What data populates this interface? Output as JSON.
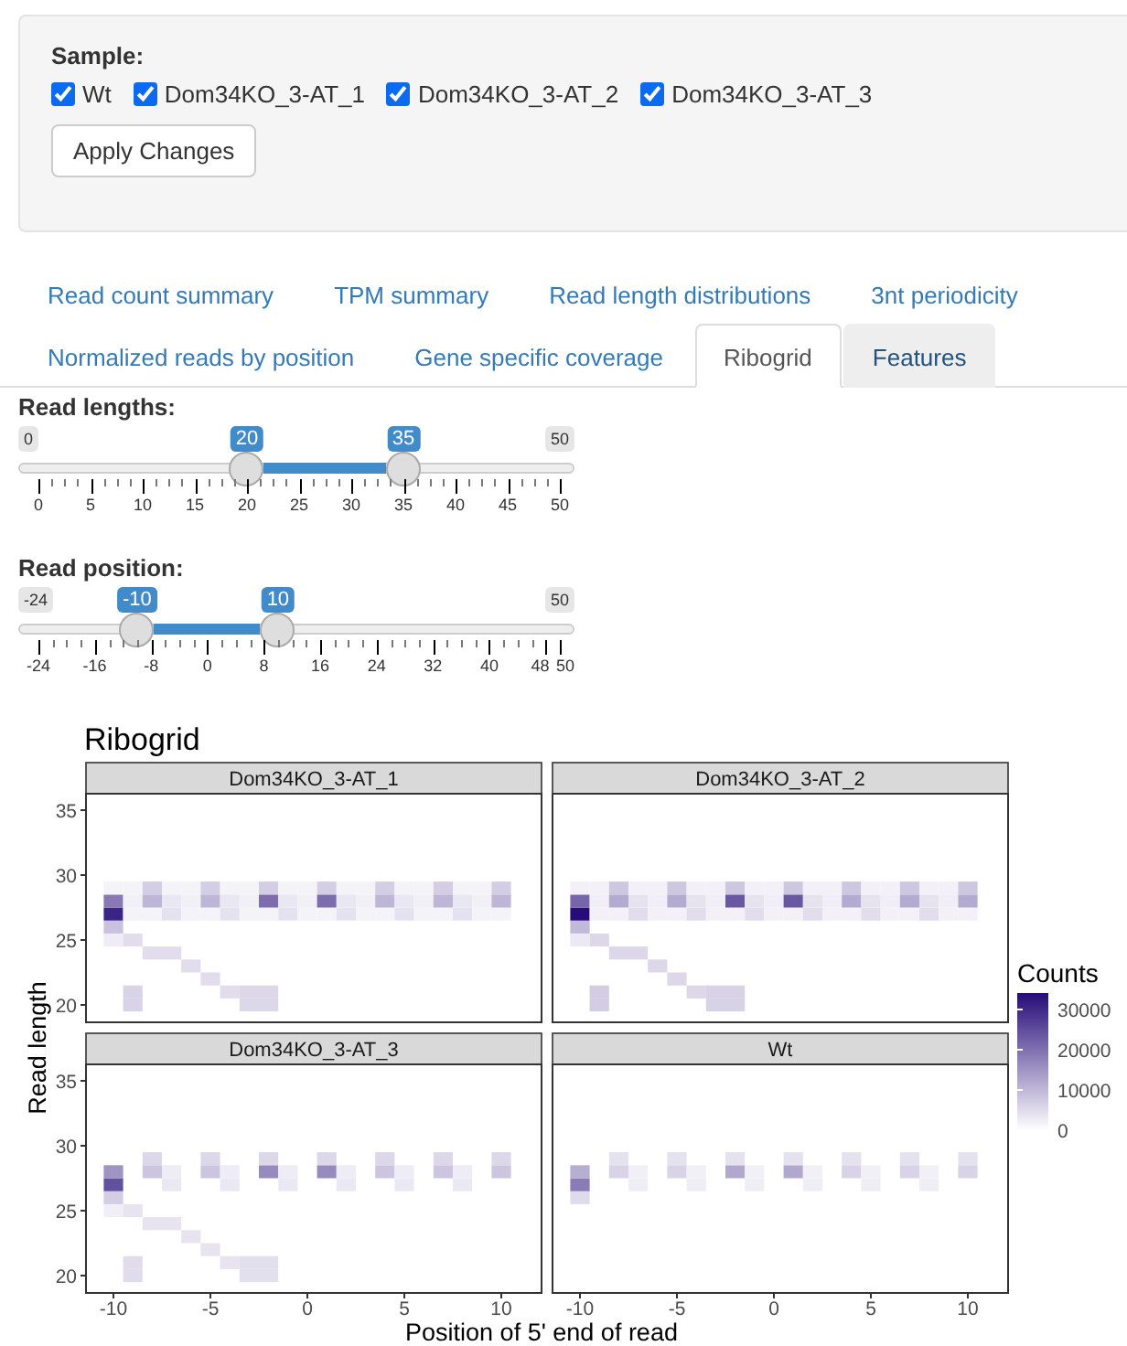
{
  "sample_panel": {
    "label": "Sample:",
    "options": [
      {
        "label": "Wt",
        "checked": true
      },
      {
        "label": "Dom34KO_3-AT_1",
        "checked": true
      },
      {
        "label": "Dom34KO_3-AT_2",
        "checked": true
      },
      {
        "label": "Dom34KO_3-AT_3",
        "checked": true
      }
    ],
    "apply_button": "Apply Changes"
  },
  "tabs": [
    {
      "label": "Read count summary",
      "selected": false,
      "highlighted": false
    },
    {
      "label": "TPM summary",
      "selected": false,
      "highlighted": false
    },
    {
      "label": "Read length distributions",
      "selected": false,
      "highlighted": false
    },
    {
      "label": "3nt periodicity",
      "selected": false,
      "highlighted": false
    },
    {
      "label": "Normalized reads by position",
      "selected": false,
      "highlighted": false
    },
    {
      "label": "Gene specific coverage",
      "selected": false,
      "highlighted": false
    },
    {
      "label": "Ribogrid",
      "selected": true,
      "highlighted": false
    },
    {
      "label": "Features",
      "selected": false,
      "highlighted": true
    }
  ],
  "sliders": [
    {
      "label": "Read lengths:",
      "min": "0",
      "max": "50",
      "from": "20",
      "to": "35",
      "ticks": [
        "0",
        "5",
        "10",
        "15",
        "20",
        "25",
        "30",
        "35",
        "40",
        "45",
        "50"
      ]
    },
    {
      "label": "Read position:",
      "min": "-24",
      "max": "50",
      "from": "-10",
      "to": "10",
      "ticks": [
        "-24",
        "-16",
        "-8",
        "0",
        "8",
        "16",
        "24",
        "32",
        "40",
        "48",
        "50"
      ]
    }
  ],
  "plot": {
    "title": "Ribogrid",
    "facets": [
      "Dom34KO_3-AT_1",
      "Dom34KO_3-AT_2",
      "Dom34KO_3-AT_3",
      "Wt"
    ],
    "y_ticks_rows": [
      [
        "35",
        "30",
        "25",
        "20"
      ],
      [
        "35",
        "30",
        "25",
        "20"
      ]
    ],
    "x_ticks_cols": [
      [
        "-10",
        "-5",
        "0",
        "5",
        "10"
      ],
      [
        "-10",
        "-5",
        "0",
        "5",
        "10"
      ]
    ],
    "ylabel": "Read length",
    "xlabel": "Position of 5' end of read",
    "legend": {
      "title": "Counts",
      "labels": [
        "30000",
        "20000",
        "10000",
        "0"
      ]
    }
  }
}
